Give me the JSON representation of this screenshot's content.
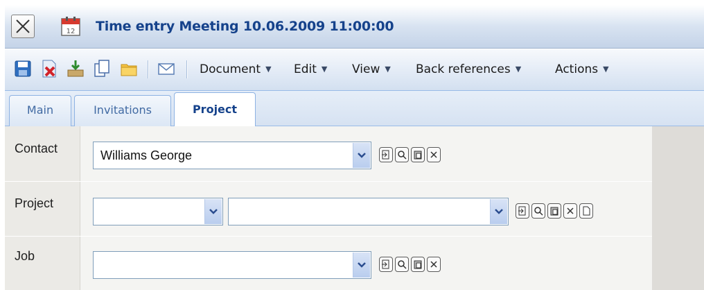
{
  "window": {
    "title": "Time entry Meeting 10.06.2009 11:00:00",
    "calendar_day": "12"
  },
  "toolbar": {
    "icons": [
      "save-icon",
      "delete-icon",
      "export-icon",
      "copy-icon",
      "folder-icon",
      "email-icon"
    ],
    "menus": [
      {
        "label": "Document"
      },
      {
        "label": "Edit"
      },
      {
        "label": "View"
      },
      {
        "label": "Back references"
      },
      {
        "label": "Actions"
      }
    ]
  },
  "tabs": [
    {
      "label": "Main",
      "active": false
    },
    {
      "label": "Invitations",
      "active": false
    },
    {
      "label": "Project",
      "active": true
    }
  ],
  "form": {
    "contact": {
      "label": "Contact",
      "value": "Williams George"
    },
    "project": {
      "label": "Project",
      "value_1": "",
      "value_2": ""
    },
    "job": {
      "label": "Job",
      "value": ""
    }
  },
  "colors": {
    "title_text": "#15428b",
    "toolbar_bg": "#e3ebf6",
    "form_bg": "#f4f4f2",
    "tab_border": "#8db2e3"
  }
}
